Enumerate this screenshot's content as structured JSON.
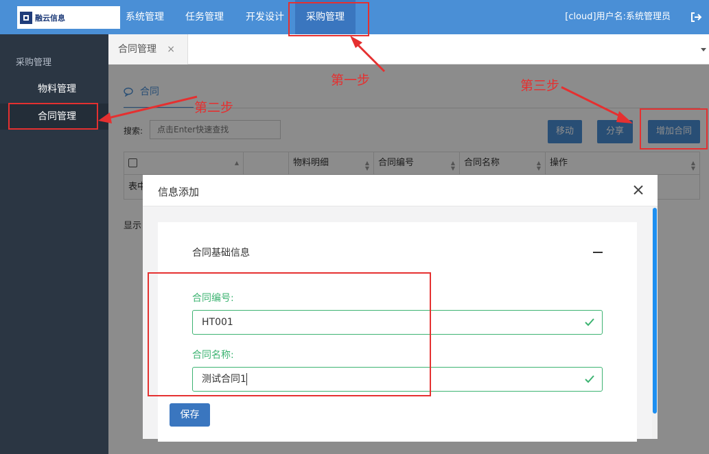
{
  "header": {
    "logo_text": "融云信息",
    "nav": [
      "系统管理",
      "任务管理",
      "开发设计",
      "采购管理"
    ],
    "user": "[cloud]用户名:系统管理员"
  },
  "sidebar": {
    "group": "采购管理",
    "items": [
      "物料管理",
      "合同管理"
    ]
  },
  "tabs": {
    "active": "合同管理",
    "close_glyph": "×"
  },
  "content": {
    "tab": "合同",
    "search_label": "搜索:",
    "search_placeholder": "点击Enter快速查找",
    "buttons": {
      "move": "移动",
      "share": "分享",
      "add": "增加合同"
    },
    "columns": [
      "物料明细",
      "合同编号",
      "合同名称",
      "操作"
    ],
    "row_text": "表中",
    "showing": "显示"
  },
  "modal": {
    "title": "信息添加",
    "section": "合同基础信息",
    "fields": [
      {
        "label": "合同编号:",
        "value": "HT001"
      },
      {
        "label": "合同名称:",
        "value": "测试合同1"
      }
    ],
    "save": "保存"
  },
  "annotations": {
    "step1": "第一步",
    "step2": "第二步",
    "step3": "第三步"
  },
  "colors": {
    "primary": "#4a8fd6",
    "sidebar": "#2b3643",
    "valid": "#3cb371",
    "annotation": "#e53030"
  }
}
